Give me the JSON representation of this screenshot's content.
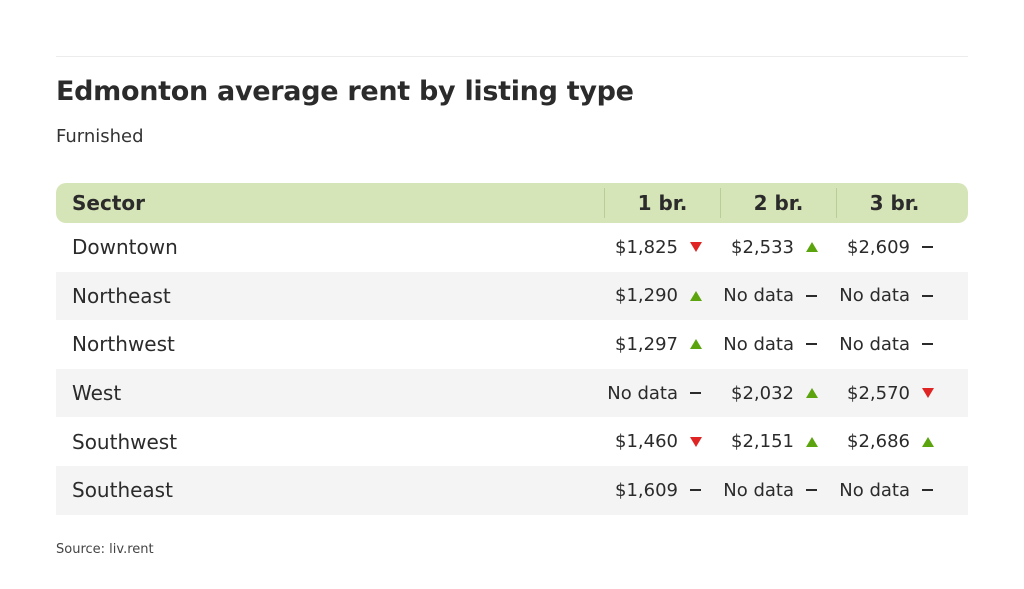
{
  "header": {
    "title": "Edmonton average rent by listing type",
    "subtitle": "Furnished"
  },
  "colors": {
    "header_bg": "#d5e5b8",
    "up": "#5ba40e",
    "down": "#e02424",
    "alt_row": "#f4f4f4"
  },
  "chart_data": {
    "type": "table",
    "title": "Edmonton average rent by listing type",
    "subtitle": "Furnished",
    "columns": [
      "Sector",
      "1 br.",
      "2 br.",
      "3 br."
    ],
    "rows": [
      {
        "sector": "Downtown",
        "cells": [
          {
            "value": "$1,825",
            "trend": "down"
          },
          {
            "value": "$2,533",
            "trend": "up"
          },
          {
            "value": "$2,609",
            "trend": "flat"
          }
        ]
      },
      {
        "sector": "Northeast",
        "cells": [
          {
            "value": "$1,290",
            "trend": "up"
          },
          {
            "value": "No data",
            "trend": "flat"
          },
          {
            "value": "No data",
            "trend": "flat"
          }
        ]
      },
      {
        "sector": "Northwest",
        "cells": [
          {
            "value": "$1,297",
            "trend": "up"
          },
          {
            "value": "No data",
            "trend": "flat"
          },
          {
            "value": "No data",
            "trend": "flat"
          }
        ]
      },
      {
        "sector": "West",
        "cells": [
          {
            "value": "No data",
            "trend": "flat"
          },
          {
            "value": "$2,032",
            "trend": "up"
          },
          {
            "value": "$2,570",
            "trend": "down"
          }
        ]
      },
      {
        "sector": "Southwest",
        "cells": [
          {
            "value": "$1,460",
            "trend": "down"
          },
          {
            "value": "$2,151",
            "trend": "up"
          },
          {
            "value": "$2,686",
            "trend": "up"
          }
        ]
      },
      {
        "sector": "Southeast",
        "cells": [
          {
            "value": "$1,609",
            "trend": "flat"
          },
          {
            "value": "No data",
            "trend": "flat"
          },
          {
            "value": "No data",
            "trend": "flat"
          }
        ]
      }
    ],
    "source": "Source: liv.rent"
  },
  "footer": {
    "source": "Source: liv.rent"
  }
}
